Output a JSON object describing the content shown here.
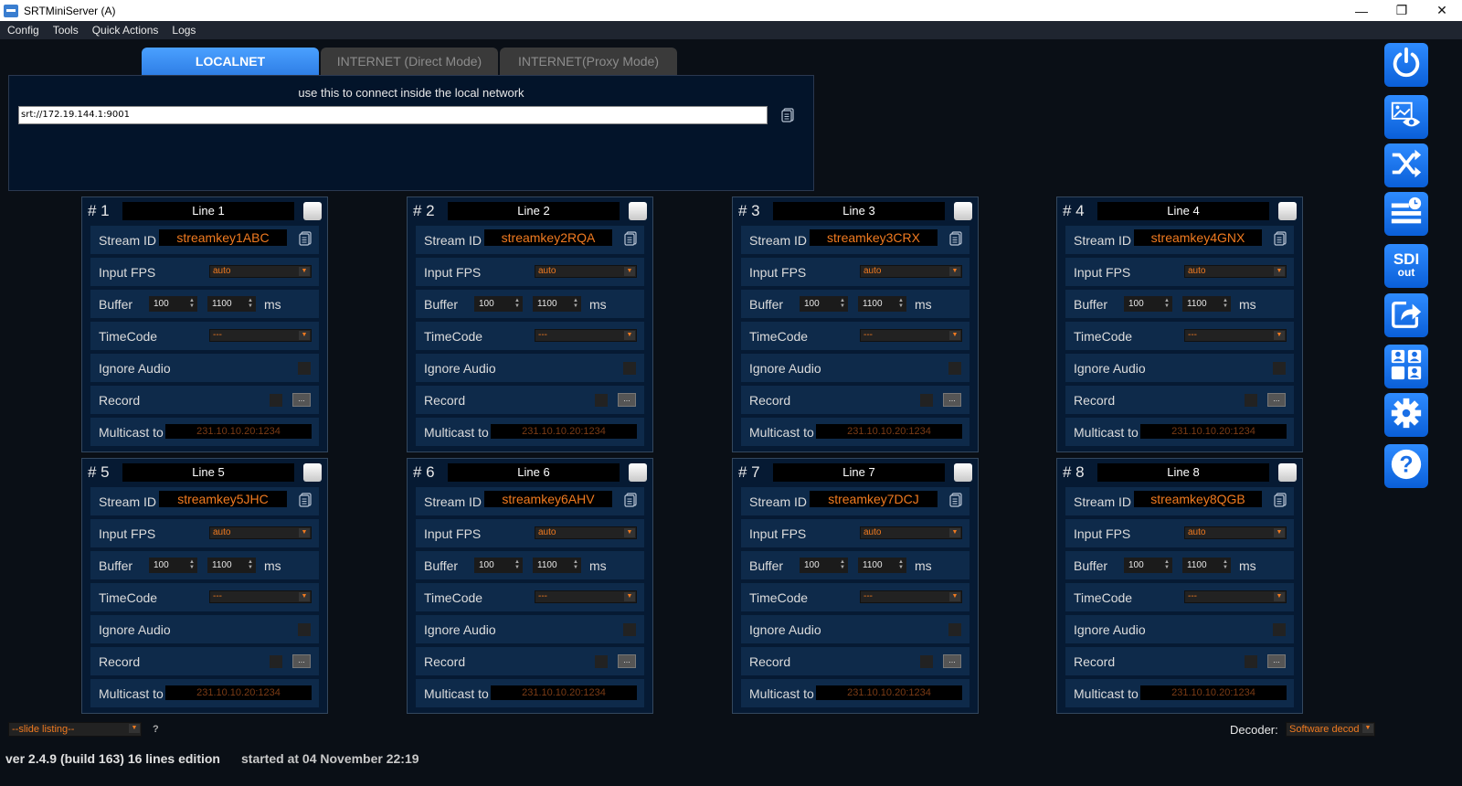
{
  "window": {
    "title": "SRTMiniServer (A)",
    "controls": {
      "minimize": "—",
      "restore": "❐",
      "close": "✕"
    }
  },
  "menu": [
    "Config",
    "Tools",
    "Quick Actions",
    "Logs"
  ],
  "tabs": [
    {
      "label": "LOCALNET",
      "active": true
    },
    {
      "label": "INTERNET (Direct Mode)",
      "active": false
    },
    {
      "label": "INTERNET(Proxy Mode)",
      "active": false
    }
  ],
  "network": {
    "hint": "use this to connect inside the local network",
    "url": "srt://172.19.144.1:9001"
  },
  "labels": {
    "stream_id": "Stream ID",
    "input_fps": "Input FPS",
    "buffer": "Buffer",
    "ms": "ms",
    "timecode": "TimeCode",
    "ignore_audio": "Ignore Audio",
    "record": "Record",
    "multicast": "Multicast to",
    "record_browse": "..."
  },
  "lines": [
    {
      "num": "# 1",
      "name": "Line 1",
      "stream_id": "streamkey1ABC",
      "fps": "auto",
      "buffer_min": "100",
      "buffer_max": "1100",
      "timecode": "---",
      "multicast": "231.10.10.20:1234"
    },
    {
      "num": "# 2",
      "name": "Line 2",
      "stream_id": "streamkey2RQA",
      "fps": "auto",
      "buffer_min": "100",
      "buffer_max": "1100",
      "timecode": "---",
      "multicast": "231.10.10.20:1234"
    },
    {
      "num": "# 3",
      "name": "Line 3",
      "stream_id": "streamkey3CRX",
      "fps": "auto",
      "buffer_min": "100",
      "buffer_max": "1100",
      "timecode": "---",
      "multicast": "231.10.10.20:1234"
    },
    {
      "num": "# 4",
      "name": "Line 4",
      "stream_id": "streamkey4GNX",
      "fps": "auto",
      "buffer_min": "100",
      "buffer_max": "1100",
      "timecode": "---",
      "multicast": "231.10.10.20:1234"
    },
    {
      "num": "# 5",
      "name": "Line 5",
      "stream_id": "streamkey5JHC",
      "fps": "auto",
      "buffer_min": "100",
      "buffer_max": "1100",
      "timecode": "---",
      "multicast": "231.10.10.20:1234"
    },
    {
      "num": "# 6",
      "name": "Line 6",
      "stream_id": "streamkey6AHV",
      "fps": "auto",
      "buffer_min": "100",
      "buffer_max": "1100",
      "timecode": "---",
      "multicast": "231.10.10.20:1234"
    },
    {
      "num": "# 7",
      "name": "Line 7",
      "stream_id": "streamkey7DCJ",
      "fps": "auto",
      "buffer_min": "100",
      "buffer_max": "1100",
      "timecode": "---",
      "multicast": "231.10.10.20:1234"
    },
    {
      "num": "# 8",
      "name": "Line 8",
      "stream_id": "streamkey8QGB",
      "fps": "auto",
      "buffer_min": "100",
      "buffer_max": "1100",
      "timecode": "---",
      "multicast": "231.10.10.20:1234"
    }
  ],
  "sidebar": [
    {
      "name": "power-icon"
    },
    {
      "name": "preview-icon"
    },
    {
      "name": "shuffle-icon"
    },
    {
      "name": "schedule-list-icon"
    },
    {
      "name": "sdi-out-icon",
      "text1": "SDI",
      "text2": "out"
    },
    {
      "name": "share-icon"
    },
    {
      "name": "users-grid-icon"
    },
    {
      "name": "gear-icon"
    },
    {
      "name": "help-icon"
    }
  ],
  "footer": {
    "slide_listing": "--slide listing--",
    "slide_help": "?",
    "decoder_label": "Decoder:",
    "decoder_value": "Software decod",
    "version": "ver 2.4.9 (build 163) 16 lines edition",
    "started": "started at 04 November 22:19"
  },
  "colors": {
    "accent": "#2f7fe6",
    "stream_id_text": "#f07a20",
    "panel_bg": "#061a33",
    "row_bg": "#0e2a4a"
  }
}
